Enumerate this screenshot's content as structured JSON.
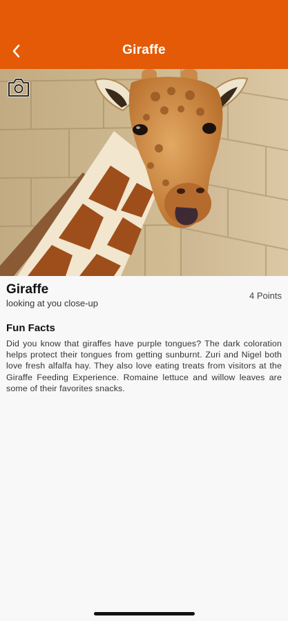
{
  "header": {
    "title": "Giraffe",
    "back_icon": "chevron-left-icon"
  },
  "photo": {
    "camera_icon": "camera-icon"
  },
  "animal": {
    "name": "Giraffe",
    "subtitle": "looking at you close-up",
    "points": "4 Points"
  },
  "facts": {
    "heading": "Fun Facts",
    "body": "Did you know that giraffes have purple tongues? The dark coloration helps protect their tongues from getting sunburnt. Zuri and Nigel both love fresh alfalfa hay. They also love eating treats from visitors at the Giraffe Feeding Experience. Romaine lettuce and willow leaves are some of their favorites snacks."
  },
  "colors": {
    "accent": "#e45a06",
    "background": "#f8f8f8"
  }
}
